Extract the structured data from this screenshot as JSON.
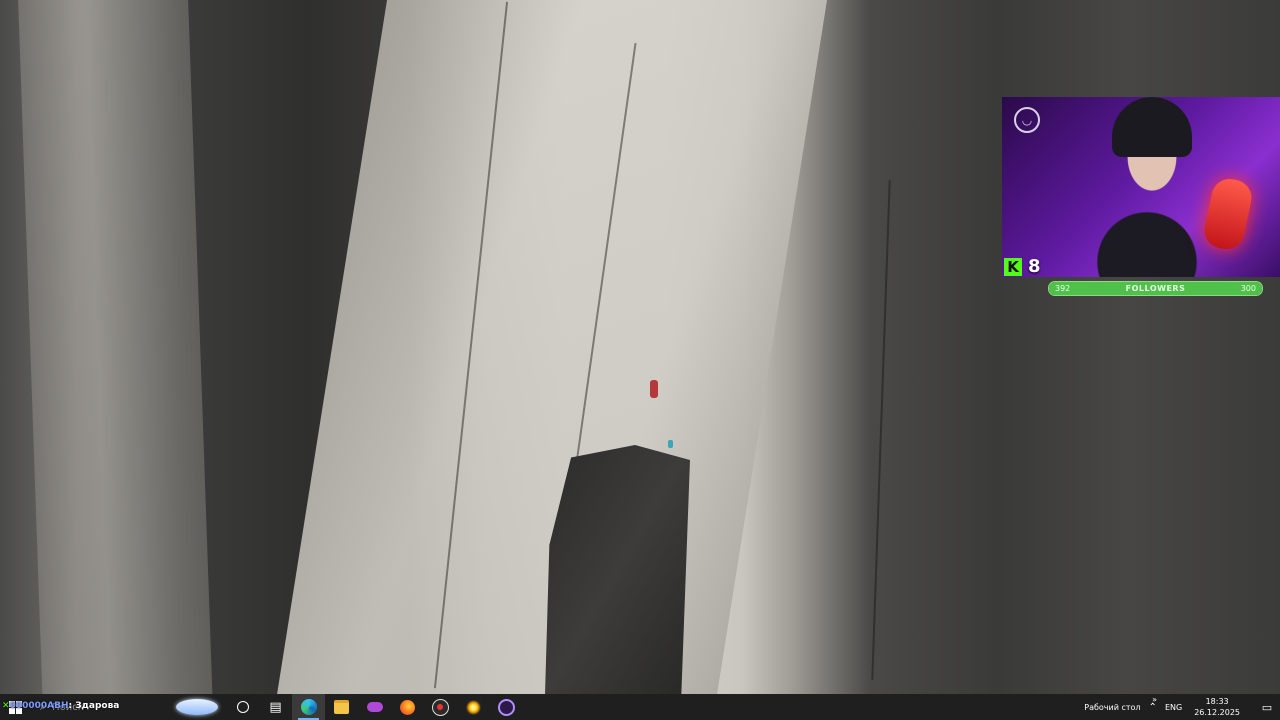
{
  "webcam": {
    "logo_icon": "broadcast-logo-icon",
    "viewer_platform_icon": "kick-logo-icon",
    "viewer_platform_letter": "K",
    "viewer_count": "8",
    "followers_goal": {
      "label": "FOLLOWERS",
      "current": "392",
      "target": "300",
      "fill_fraction": 1.0
    }
  },
  "ticker": {
    "prefix": "✕",
    "name": "000000АВН",
    "separator": ":",
    "message": "Здарова"
  },
  "taskbar": {
    "search_placeholder": "Поиск",
    "items": [
      {
        "name": "cortana-icon",
        "active": false
      },
      {
        "name": "task-view-icon",
        "active": false
      },
      {
        "name": "edge-icon",
        "active": true
      },
      {
        "name": "file-explorer-icon",
        "active": false
      },
      {
        "name": "mask-app-icon",
        "active": false
      },
      {
        "name": "firefox-icon",
        "active": false
      },
      {
        "name": "obs-icon",
        "active": false
      },
      {
        "name": "burst-app-icon",
        "active": false
      },
      {
        "name": "ring-app-icon",
        "active": false
      }
    ],
    "tray": {
      "desktop_label": "Рабочий стол",
      "desktop_arrows": "»",
      "language": "ENG",
      "time": "18:33",
      "date": "26.12.2025"
    }
  },
  "colors": {
    "kick_green": "#53fc18",
    "taskbar_bg": "#1f1f1f",
    "active_indicator": "#6fb5ff"
  }
}
